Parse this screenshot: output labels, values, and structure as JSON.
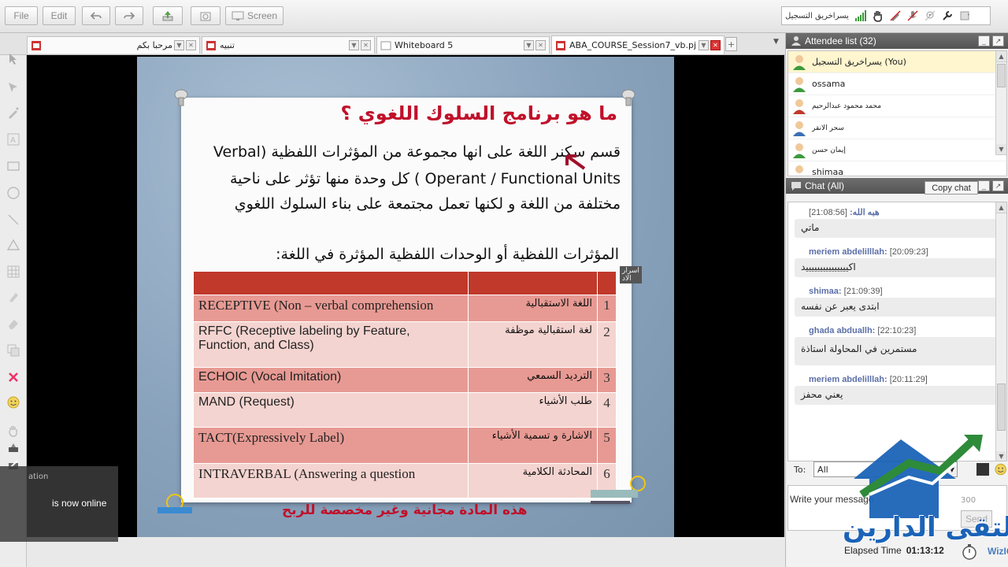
{
  "toolbar": {
    "file_label": "File",
    "edit_label": "Edit",
    "screen_label": "Screen",
    "user_name": "يسراخريق التسجيل"
  },
  "tabs": [
    {
      "label": "مرحبا بكم"
    },
    {
      "label": "تنبيه"
    },
    {
      "label": "Whiteboard 5"
    },
    {
      "label": "ABA_COURSE_Session7_vb.pj"
    }
  ],
  "slide": {
    "title": "ما هو برنامج السلوك اللغوي ؟",
    "para_line1": "قسم سكنر اللغة على انها مجموعة من المؤثرات اللفظية (Verbal",
    "para_line2": "Operant / Functional Units ) كل وحدة منها تؤثر على ناحية",
    "para_line3": "مختلفة من اللغة و لكنها تعمل مجتمعة على بناء السلوك اللغوي",
    "subheading": "المؤثرات اللفظية أو الوحدات اللفظية المؤثرة في اللغة:",
    "cursor_tip": "اسرار الاد",
    "rows": [
      {
        "eng": "RECEPTIVE (Non – verbal comprehension",
        "arb": "اللغة الاستقبالية",
        "num": "1"
      },
      {
        "eng": "RFFC (Receptive labeling by Feature, Function, and Class)",
        "arb": "لغة استقبالية موظفة",
        "num": "2"
      },
      {
        "eng": "ECHOIC (Vocal Imitation)",
        "arb": "الترديد السمعي",
        "num": "3"
      },
      {
        "eng": "MAND (Request)",
        "arb": "طلب الأشياء",
        "num": "4"
      },
      {
        "eng": "TACT(Expressively Label)",
        "arb": "الاشارة و تسمية الأشياء",
        "num": "5"
      },
      {
        "eng": "INTRAVERBAL (Answering a question",
        "arb": "المحادثة الكلامية",
        "num": "6"
      }
    ],
    "footer": "هذه المادة مجانية وغير مخصصة للربح"
  },
  "toast": {
    "title": "ation",
    "message": "is now online"
  },
  "attendees": {
    "header": "Attendee list (32)",
    "items": [
      {
        "name": "يسراخريق التسجيل (You)",
        "you": true
      },
      {
        "name": "ossama"
      },
      {
        "name": "محمد محمود عبدالرحيم"
      },
      {
        "name": "سحر الانقر"
      },
      {
        "name": "إيمان حسن"
      },
      {
        "name": "shimaa"
      }
    ]
  },
  "chat": {
    "header": "Chat (All)",
    "copy_label": "Copy chat",
    "messages": [
      {
        "sender": "هبه الله:",
        "time": "[21:08:56]",
        "text": "ماتي"
      },
      {
        "sender": "meriem abdelilllah:",
        "time": "[20:09:23]",
        "text": "اكيييييييييييييييد"
      },
      {
        "sender": "shimaa:",
        "time": "[21:09:39]",
        "text": "ابتدى يعبر عن نفسه"
      },
      {
        "sender": "ghada abduallh:",
        "time": "[22:10:23]",
        "text": "مستمرين في المحاولة استاذة"
      },
      {
        "sender": "meriem abdelilllah:",
        "time": "[20:11:29]",
        "text": "يعني محفز"
      }
    ],
    "to_label": "To:",
    "to_value": "All",
    "input_placeholder": "Write your message",
    "char_count": "300",
    "send_label": "Send"
  },
  "elapsed": {
    "label": "Elapsed Time",
    "value": "01:13:12"
  },
  "brand": "WizIQ",
  "watermark": "ملتقى الدارين",
  "colors": {
    "accent_red": "#c0102a",
    "table_header": "#c0392b",
    "row_dark": "#e79a93",
    "row_light": "#f4d4d0",
    "logo_blue": "#1b63b7",
    "logo_green": "#2e8b3a"
  }
}
